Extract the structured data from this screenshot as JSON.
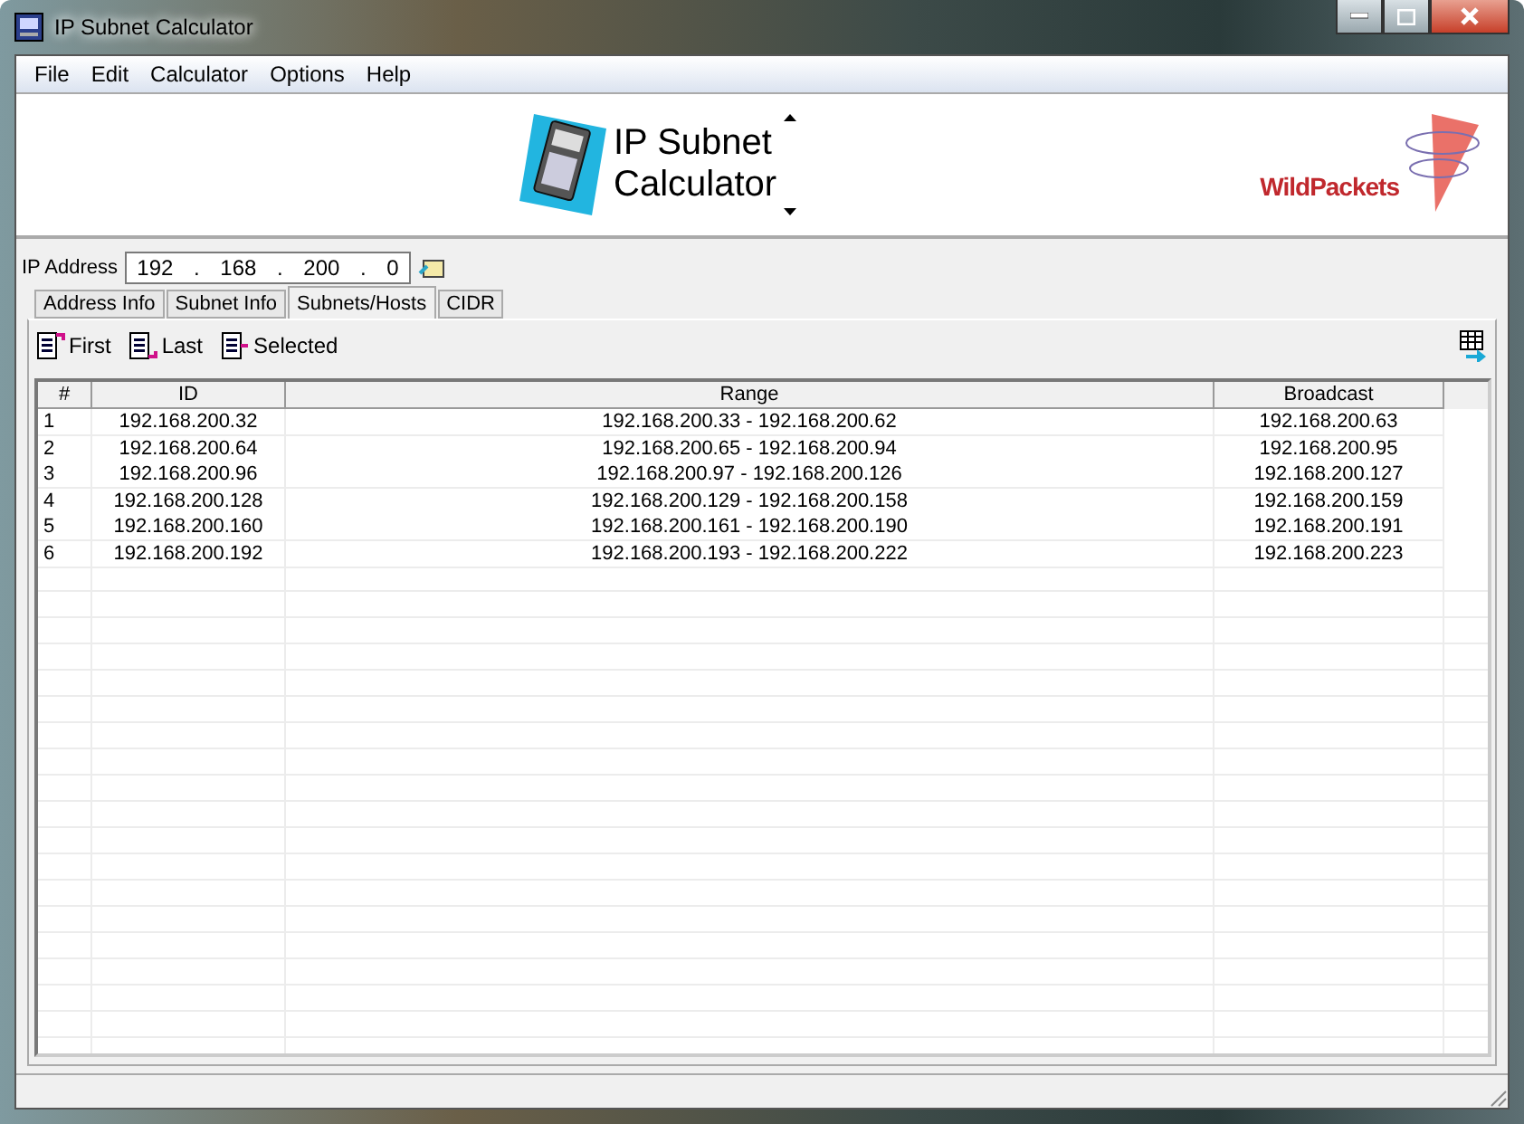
{
  "window": {
    "title": "IP Subnet Calculator"
  },
  "menu": [
    "File",
    "Edit",
    "Calculator",
    "Options",
    "Help"
  ],
  "banner": {
    "title_lines": [
      "IP Subnet",
      "Calculator"
    ],
    "logo_text": "WildPackets"
  },
  "ip_address": {
    "label": "IP Address",
    "octets": [
      "192",
      "168",
      "200",
      "0"
    ],
    "separator": "."
  },
  "tabs": [
    {
      "label": "Address Info",
      "selected": false
    },
    {
      "label": "Subnet Info",
      "selected": false
    },
    {
      "label": "Subnets/Hosts",
      "selected": true
    },
    {
      "label": "CIDR",
      "selected": false
    }
  ],
  "toolbar": [
    "First",
    "Last",
    "Selected"
  ],
  "table": {
    "columns": [
      "#",
      "ID",
      "Range",
      "Broadcast"
    ],
    "rows": [
      [
        "1",
        "192.168.200.32",
        "192.168.200.33 - 192.168.200.62",
        "192.168.200.63"
      ],
      [
        "2",
        "192.168.200.64",
        "192.168.200.65 - 192.168.200.94",
        "192.168.200.95"
      ],
      [
        "3",
        "192.168.200.96",
        "192.168.200.97 - 192.168.200.126",
        "192.168.200.127"
      ],
      [
        "4",
        "192.168.200.128",
        "192.168.200.129 - 192.168.200.158",
        "192.168.200.159"
      ],
      [
        "5",
        "192.168.200.160",
        "192.168.200.161 - 192.168.200.190",
        "192.168.200.191"
      ],
      [
        "6",
        "192.168.200.192",
        "192.168.200.193 - 192.168.200.222",
        "192.168.200.223"
      ]
    ]
  }
}
